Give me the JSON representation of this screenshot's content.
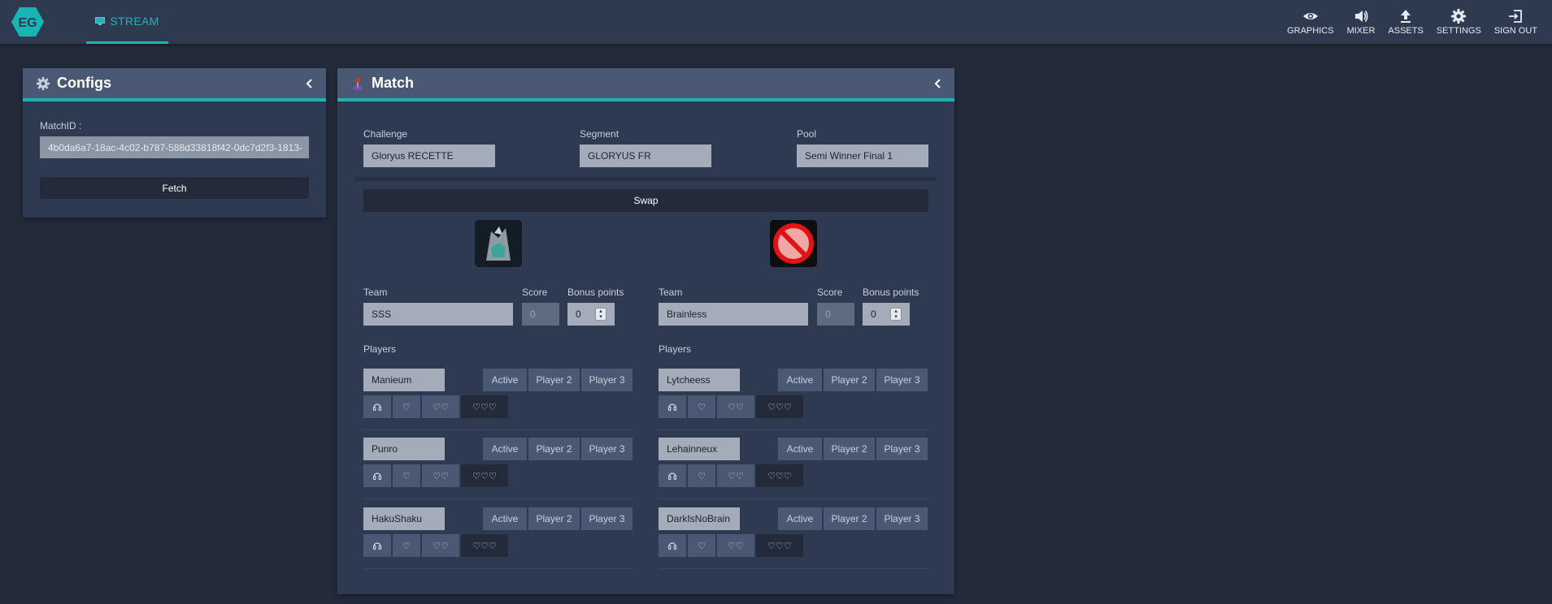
{
  "nav": {
    "stream_label": "STREAM",
    "items": [
      {
        "label": "GRAPHICS",
        "icon": "eye-icon"
      },
      {
        "label": "MIXER",
        "icon": "speaker-icon"
      },
      {
        "label": "ASSETS",
        "icon": "upload-icon"
      },
      {
        "label": "SETTINGS",
        "icon": "gear-icon"
      },
      {
        "label": "SIGN OUT",
        "icon": "sign-out-icon"
      }
    ]
  },
  "configs": {
    "title": "Configs",
    "matchid_label": "MatchID :",
    "matchid_value": "4b0da6a7-18ac-4c02-b787-588d33818f42-0dc7d2f3-1813-",
    "fetch_label": "Fetch"
  },
  "match": {
    "title": "Match",
    "challenge_label": "Challenge",
    "challenge_value": "Gloryus RECETTE",
    "segment_label": "Segment",
    "segment_value": "GLORYUS FR",
    "pool_label": "Pool",
    "pool_value": "Semi Winner Final 1",
    "swap_label": "Swap",
    "team_label": "Team",
    "score_label": "Score",
    "bonus_label": "Bonus points",
    "players_label": "Players",
    "slot_labels": [
      "Active",
      "Player 2",
      "Player 3"
    ],
    "heart_labels": [
      "♡",
      "♡♡",
      "♡♡♡"
    ],
    "teams": [
      {
        "name": "SSS",
        "score_placeholder": "0",
        "bonus": "0",
        "players": [
          "Manieum",
          "Punro",
          "HakuShaku"
        ]
      },
      {
        "name": "Brainless",
        "score_placeholder": "0",
        "bonus": "0",
        "players": [
          "Lytcheess",
          "Lehainneux",
          "DarkIsNoBrain"
        ]
      }
    ]
  }
}
